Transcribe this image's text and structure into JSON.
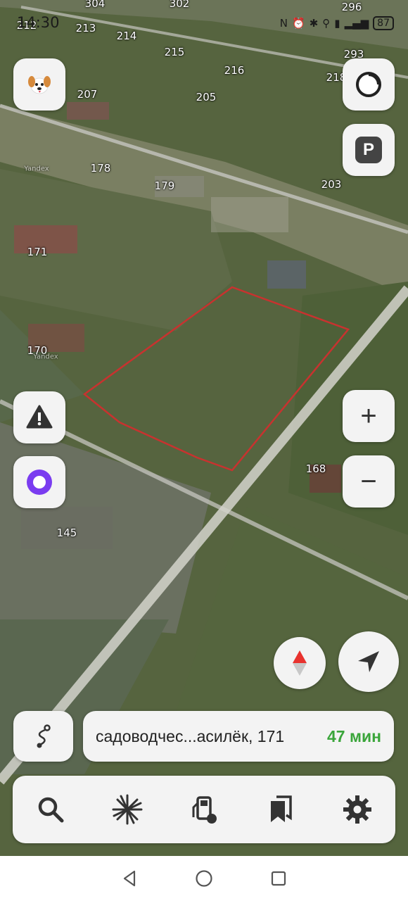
{
  "status": {
    "time": "14:30",
    "battery": "87"
  },
  "map": {
    "labels": [
      "304",
      "302",
      "296",
      "212",
      "213",
      "214",
      "215",
      "216",
      "293",
      "218",
      "207",
      "205",
      "178",
      "179",
      "203",
      "171",
      "170",
      "168",
      "145"
    ],
    "watermarks": [
      "Yandex",
      "Yandex"
    ]
  },
  "route": {
    "destination": "садоводчес...асилёк, 171",
    "time": "47 мин"
  },
  "icons": {
    "profile": "dog-avatar-icon",
    "layers": "layers-icon",
    "parking": "P",
    "alert": "warning-icon",
    "alice": "alice-icon",
    "compass": "compass-icon",
    "locate": "location-arrow-icon",
    "route": "route-icon",
    "search": "search-icon",
    "discover": "discover-icon",
    "fuel": "fuel-icon",
    "bookmarks": "bookmarks-icon",
    "settings": "gear-icon",
    "zoom_in": "+",
    "zoom_out": "−"
  },
  "colors": {
    "plot_outline": "#c8322f",
    "route_time": "#3aa53a",
    "alice": "#7a3cf0"
  }
}
